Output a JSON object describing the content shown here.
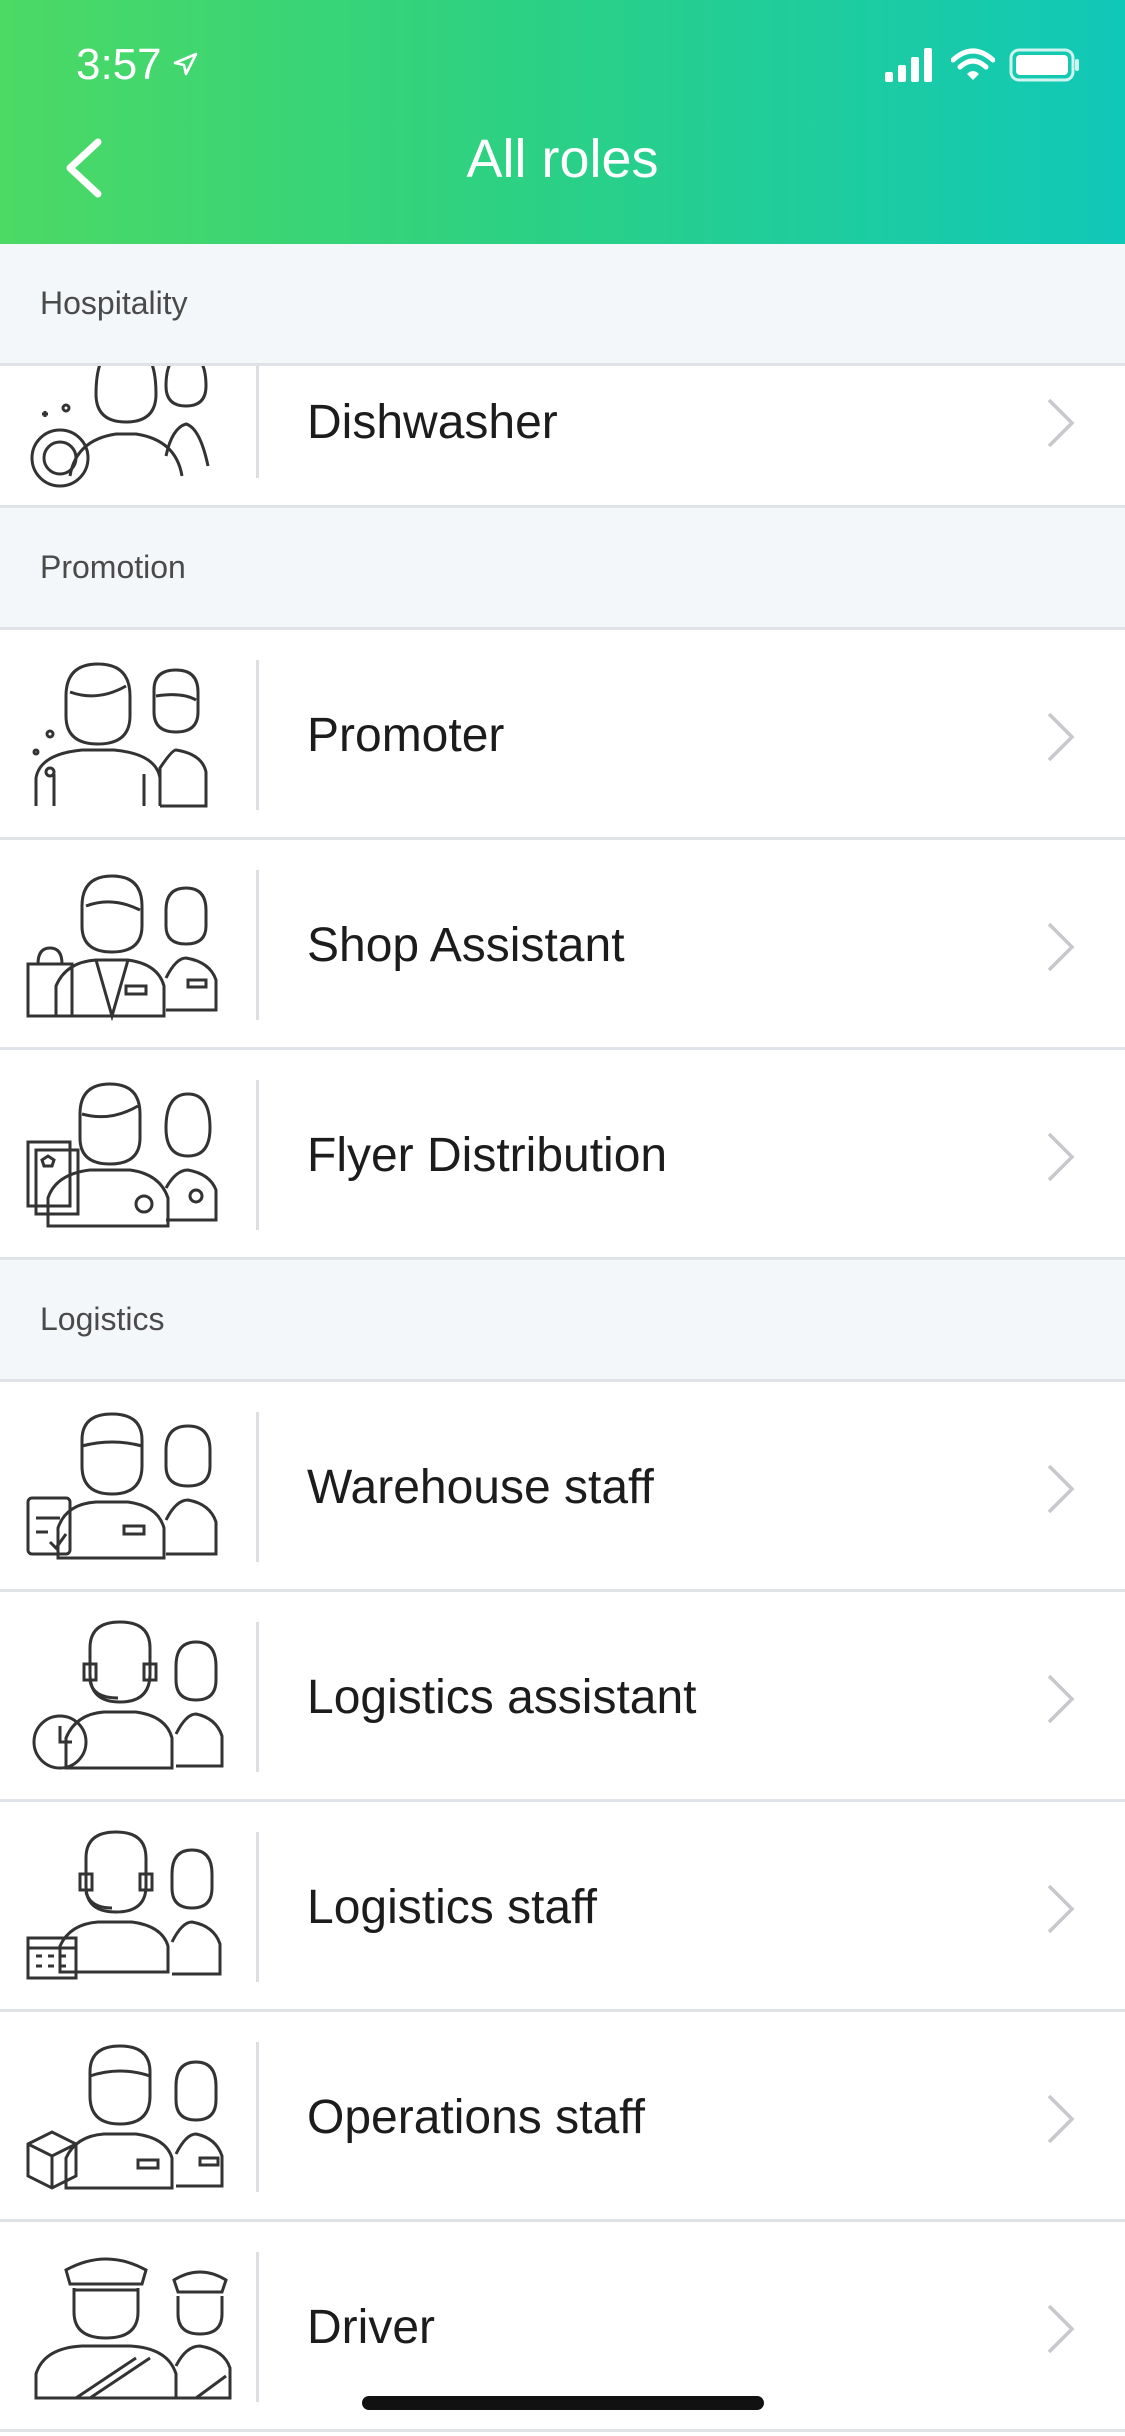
{
  "status_bar": {
    "time": "3:57"
  },
  "header": {
    "title": "All roles"
  },
  "sections": [
    {
      "title": "Hospitality",
      "items": [
        {
          "label": "Dishwasher",
          "icon": "dishwasher-icon"
        }
      ]
    },
    {
      "title": "Promotion",
      "items": [
        {
          "label": "Promoter",
          "icon": "promoter-icon"
        },
        {
          "label": "Shop Assistant",
          "icon": "shop-assistant-icon"
        },
        {
          "label": "Flyer Distribution",
          "icon": "flyer-distribution-icon"
        }
      ]
    },
    {
      "title": "Logistics",
      "items": [
        {
          "label": "Warehouse staff",
          "icon": "warehouse-staff-icon"
        },
        {
          "label": "Logistics assistant",
          "icon": "logistics-assistant-icon"
        },
        {
          "label": "Logistics staff",
          "icon": "logistics-staff-icon"
        },
        {
          "label": "Operations staff",
          "icon": "operations-staff-icon"
        },
        {
          "label": "Driver",
          "icon": "driver-icon"
        }
      ]
    }
  ],
  "colors": {
    "gradient_start": "#4cd964",
    "gradient_end": "#10c8b8",
    "section_bg": "#f4f7fa",
    "divider": "#dfe3e7",
    "chevron": "#c7c7cc"
  }
}
